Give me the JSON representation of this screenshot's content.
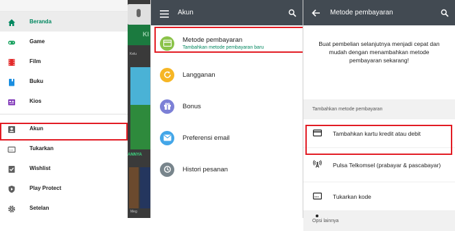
{
  "panel1": {
    "background": {
      "green_tab_text": "KI",
      "small_label": "Kelu",
      "hint_text": "ANNYA",
      "bottom_label": "Meg"
    },
    "drawer_items": [
      {
        "label": "Beranda",
        "icon": "home-icon"
      },
      {
        "label": "Game",
        "icon": "gamepad-icon"
      },
      {
        "label": "Film",
        "icon": "film-icon"
      },
      {
        "label": "Buku",
        "icon": "book-icon"
      },
      {
        "label": "Kios",
        "icon": "newsstand-icon"
      },
      {
        "label": "Akun",
        "icon": "account-icon"
      },
      {
        "label": "Tukarkan",
        "icon": "redeem-icon"
      },
      {
        "label": "Wishlist",
        "icon": "wishlist-icon"
      },
      {
        "label": "Play Protect",
        "icon": "shield-icon"
      },
      {
        "label": "Setelan",
        "icon": "gear-icon"
      }
    ],
    "active_color": "#01875f"
  },
  "panel2": {
    "title": "Akun",
    "items": [
      {
        "label": "Metode pembayaran",
        "sublabel": "Tambahkan metode pembayaran baru",
        "icon": "credit-card-icon",
        "color": "#8bc34a"
      },
      {
        "label": "Langganan",
        "icon": "subscription-icon",
        "color": "#f6b625"
      },
      {
        "label": "Bonus",
        "icon": "gift-icon",
        "color": "#7c80d6"
      },
      {
        "label": "Preferensi email",
        "icon": "email-icon",
        "color": "#43a6e8"
      },
      {
        "label": "Histori pesanan",
        "icon": "history-icon",
        "color": "#78858c"
      }
    ]
  },
  "panel3": {
    "title": "Metode pembayaran",
    "intro": "Buat pembelian selanjutnya menjadi cepat dan mudah dengan menambahkan metode pembayaran sekarang!",
    "section_add": "Tambahkan metode pembayaran",
    "methods": [
      {
        "label": "Tambahkan kartu kredit atau debit",
        "icon": "credit-card-icon"
      },
      {
        "label": "Pulsa Telkomsel (prabayar & pascabayar)",
        "icon": "carrier-billing-icon"
      },
      {
        "label": "Tukarkan kode",
        "icon": "redeem-code-icon"
      }
    ],
    "section_other": "Opsi lainnya"
  },
  "colors": {
    "toolbar": "#424a52",
    "highlight": "#e21b23"
  }
}
